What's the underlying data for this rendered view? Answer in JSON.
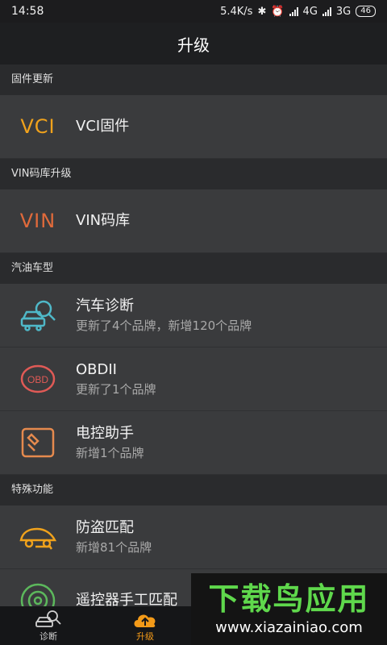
{
  "status_bar": {
    "time": "14:58",
    "net_speed": "5.4K/s",
    "network_1": "4G",
    "network_2": "3G",
    "battery": "46"
  },
  "title": "升级",
  "sections": [
    {
      "header": "固件更新",
      "items": [
        {
          "icon": "vci-text-icon",
          "icon_text": "VCI",
          "title": "VCI固件",
          "subtitle": ""
        }
      ]
    },
    {
      "header": "VIN码库升级",
      "items": [
        {
          "icon": "vin-text-icon",
          "icon_text": "VIN",
          "title": "VIN码库",
          "subtitle": ""
        }
      ]
    },
    {
      "header": "汽油车型",
      "items": [
        {
          "icon": "car-diagnosis-icon",
          "title": "汽车诊断",
          "subtitle": "更新了4个品牌，新增120个品牌"
        },
        {
          "icon": "obd-icon",
          "icon_text": "OBD",
          "title": "OBDII",
          "subtitle": "更新了1个品牌"
        },
        {
          "icon": "control-assistant-icon",
          "title": "电控助手",
          "subtitle": "新增1个品牌"
        }
      ]
    },
    {
      "header": "特殊功能",
      "items": [
        {
          "icon": "anti-theft-key-icon",
          "title": "防盗匹配",
          "subtitle": "新增81个品牌"
        },
        {
          "icon": "remote-control-icon",
          "title": "遥控器手工匹配",
          "subtitle": ""
        }
      ]
    }
  ],
  "tabs": [
    {
      "label": "诊断",
      "icon": "diagnosis-tab-icon",
      "active": false
    },
    {
      "label": "升级",
      "icon": "upgrade-cloud-icon",
      "active": true
    }
  ],
  "watermark": {
    "big": "下载鸟应用",
    "small": "www.xiazainiao.com"
  },
  "colors": {
    "orange": "#f0a21c",
    "red_orange": "#e06a3b",
    "teal": "#4fb8c8",
    "active_tab": "#f39a18",
    "watermark_green": "#5fd84c"
  }
}
